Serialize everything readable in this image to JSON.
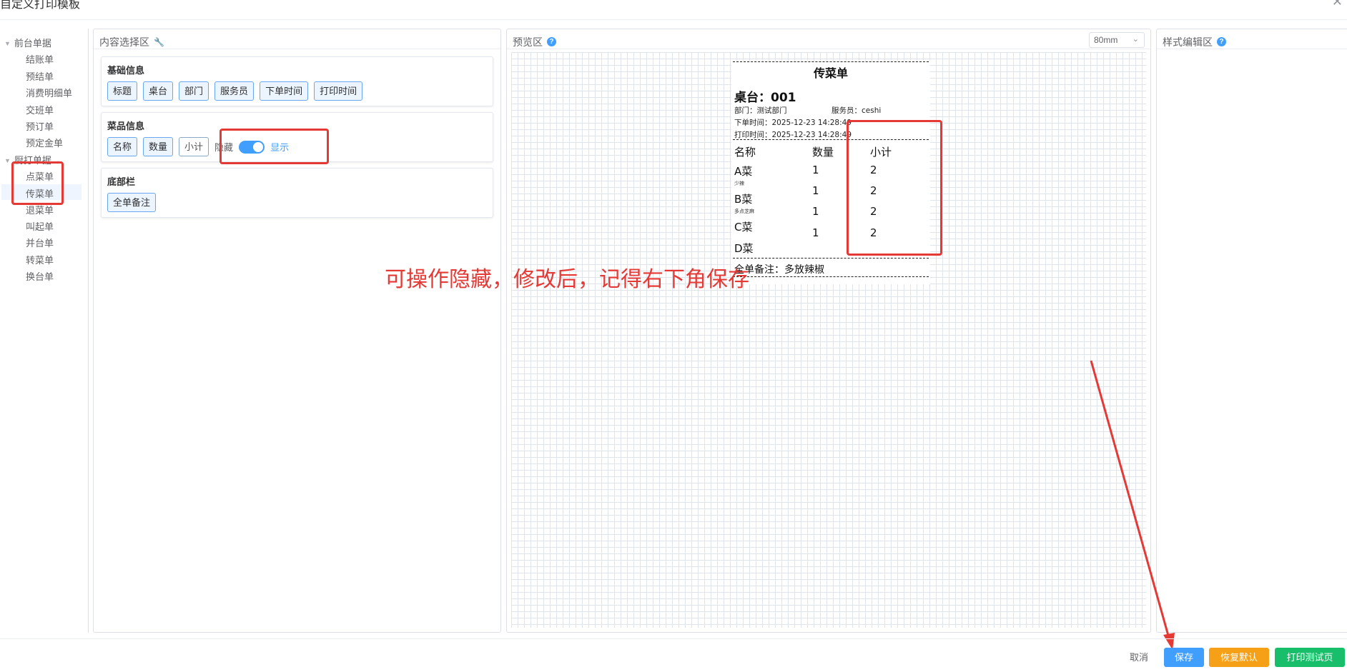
{
  "dialog": {
    "title": "自定义打印模板",
    "close_icon": "close-icon"
  },
  "tree": {
    "groups": [
      {
        "label": "前台单据",
        "items": [
          "结账单",
          "预结单",
          "消费明细单",
          "交班单",
          "预订单",
          "预定金单"
        ]
      },
      {
        "label": "厨打单据",
        "items": [
          "点菜单",
          "传菜单",
          "退菜单",
          "叫起单",
          "并台单",
          "转菜单",
          "换台单"
        ]
      }
    ],
    "selected": "传菜单"
  },
  "content_panel": {
    "title": "内容选择区",
    "sections": [
      {
        "title": "基础信息",
        "tags": [
          "标题",
          "桌台",
          "部门",
          "服务员",
          "下单时间",
          "打印时间"
        ]
      },
      {
        "title": "菜品信息",
        "tags": [
          "名称",
          "数量",
          "小计"
        ],
        "toggle": {
          "off_label": "隐藏",
          "on_label": "显示",
          "on": true
        }
      },
      {
        "title": "底部栏",
        "tags": [
          "全单备注"
        ]
      }
    ]
  },
  "preview_panel": {
    "title": "预览区",
    "paper_size": "80mm",
    "ticket": {
      "title": "传菜单",
      "table": "桌台：001",
      "dept_label": "部门：测试部门",
      "waiter_label": "服务员：ceshi",
      "order_time": "下单时间：2025-12-23 14:28:49",
      "print_time": "打印时间：2025-12-23 14:28:49",
      "headers": [
        "名称",
        "数量",
        "小计"
      ],
      "rows": [
        {
          "name": "A菜",
          "qty": "1",
          "subtotal": "2",
          "note": "少辣"
        },
        {
          "name": "B菜",
          "qty": "1",
          "subtotal": "2",
          "note": "多点芝麻"
        },
        {
          "name": "C菜",
          "qty": "1",
          "subtotal": "2",
          "note": ""
        },
        {
          "name": "D菜",
          "qty": "1",
          "subtotal": "2",
          "note": ""
        }
      ],
      "remark": "全单备注：多放辣椒"
    }
  },
  "style_panel": {
    "title": "样式编辑区"
  },
  "annotation": {
    "text": "可操作隐藏，修改后，记得右下角保存",
    "color": "#e53935"
  },
  "footer": {
    "cancel": "取消",
    "save": "保存",
    "reset": "恢复默认",
    "print_test": "打印测试页"
  }
}
